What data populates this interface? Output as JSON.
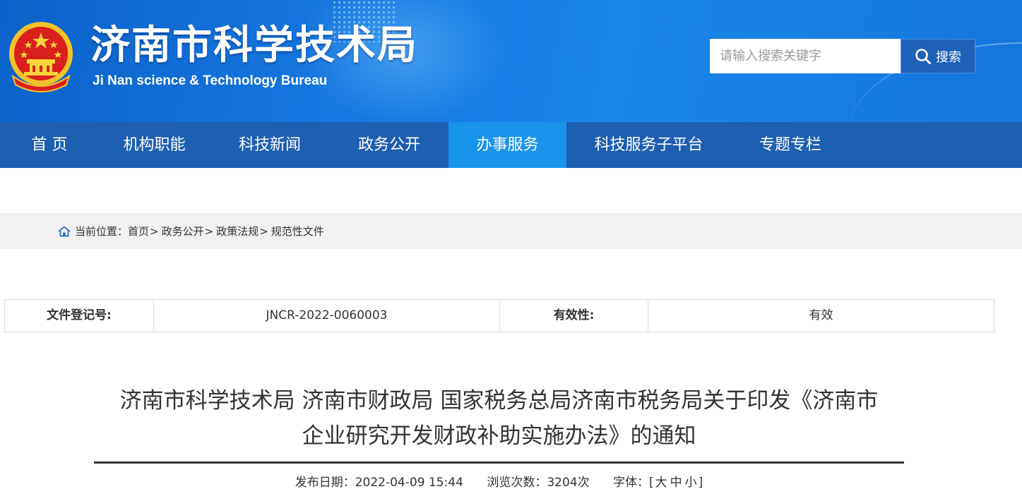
{
  "header": {
    "title": "济南市科学技术局",
    "subtitle": "Ji Nan science & Technology Bureau",
    "search": {
      "placeholder": "请输入搜索关键字",
      "button_label": "搜索"
    }
  },
  "nav": {
    "items": [
      {
        "label": "首 页"
      },
      {
        "label": "机构职能"
      },
      {
        "label": "科技新闻"
      },
      {
        "label": "政务公开"
      },
      {
        "label": "办事服务"
      },
      {
        "label": "科技服务子平台"
      },
      {
        "label": "专题专栏"
      }
    ],
    "active_index": 4
  },
  "breadcrumb": {
    "prefix": "当前位置：",
    "items": [
      "首页",
      "政务公开",
      "政策法规",
      "规范性文件"
    ],
    "separator": ">"
  },
  "info_table": {
    "reg_label": "文件登记号:",
    "reg_value": "JNCR-2022-0060003",
    "validity_label": "有效性:",
    "validity_value": "有效"
  },
  "article": {
    "title_line1": "济南市科学技术局 济南市财政局 国家税务总局济南市税务局关于印发《济南市",
    "title_line2": "企业研究开发财政补助实施办法》的通知",
    "publish_label": "发布日期：",
    "publish_date": "2022-04-09 15:44",
    "views_label": "浏览次数：",
    "views_value": "3204次",
    "font_label": "字体：",
    "font_open": "[",
    "font_large": "大",
    "font_medium": "中",
    "font_small": "小",
    "font_close": "]"
  },
  "colors": {
    "nav_bg": "#1d5fb0",
    "nav_active": "#1a93ea",
    "banner": "#1677e0"
  }
}
